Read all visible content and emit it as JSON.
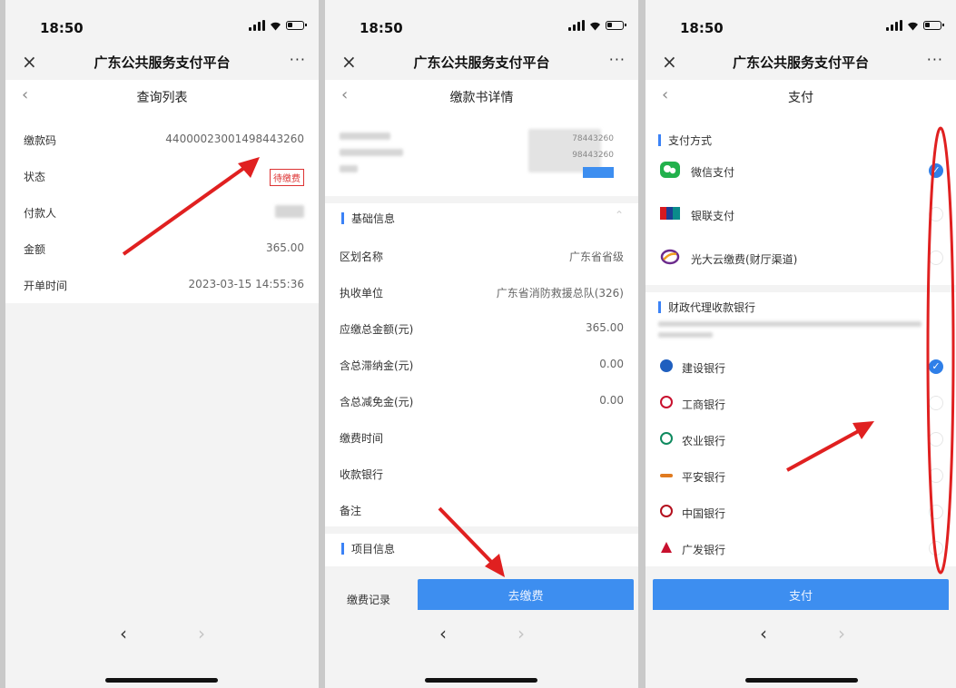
{
  "status": {
    "time": "18:50"
  },
  "app": {
    "title": "广东公共服务支付平台",
    "more": "···",
    "close": "×"
  },
  "nav": {
    "back": "‹",
    "forward": "›"
  },
  "screen1": {
    "page_title": "查询列表",
    "rows": [
      {
        "label": "缴款码",
        "value": "440000230014984432​60"
      },
      {
        "label": "状态",
        "value": "待缴费"
      },
      {
        "label": "付款人",
        "value": ""
      },
      {
        "label": "金额",
        "value": "365.00"
      },
      {
        "label": "开单时间",
        "value": "2023-03-15 14:55:36"
      }
    ]
  },
  "screen2": {
    "page_title": "缴款书详情",
    "blurred": [
      "78443260",
      "98443260"
    ],
    "basic_section": "基础信息",
    "rows": [
      {
        "label": "区划名称",
        "value": "广东省省级"
      },
      {
        "label": "执收单位",
        "value": "广东省消防救援总队(326)"
      },
      {
        "label": "应缴总金额(元)",
        "value": "365.00"
      },
      {
        "label": "含总滞纳金(元)",
        "value": "0.00"
      },
      {
        "label": "含总减免金(元)",
        "value": "0.00"
      },
      {
        "label": "缴费时间",
        "value": ""
      },
      {
        "label": "收款银行",
        "value": ""
      },
      {
        "label": "备注",
        "value": ""
      }
    ],
    "item_section": "项目信息",
    "record_label": "缴费记录",
    "pay_button": "去缴费"
  },
  "screen3": {
    "page_title": "支付",
    "method_section": "支付方式",
    "methods": [
      {
        "label": "微信支付",
        "icon": "wechat-icon",
        "selected": true
      },
      {
        "label": "银联支付",
        "icon": "unionpay-icon",
        "selected": false
      },
      {
        "label": "光大云缴费(财厅渠道)",
        "icon": "cebbank-icon",
        "selected": false
      }
    ],
    "bank_section": "财政代理收款银行",
    "banks": [
      {
        "label": "建设银行",
        "color": "#1f5fbf",
        "selected": true
      },
      {
        "label": "工商银行",
        "color": "#c8102e",
        "selected": false
      },
      {
        "label": "农业银行",
        "color": "#0f8a5f",
        "selected": false
      },
      {
        "label": "平安银行",
        "color": "#e07a1f",
        "selected": false
      },
      {
        "label": "中国银行",
        "color": "#b4101e",
        "selected": false
      },
      {
        "label": "广发银行",
        "color": "#c8102e",
        "selected": false
      }
    ],
    "pay_button": "支付"
  },
  "colors": {
    "accent": "#3d8ef0",
    "annotation": "#e02020"
  }
}
